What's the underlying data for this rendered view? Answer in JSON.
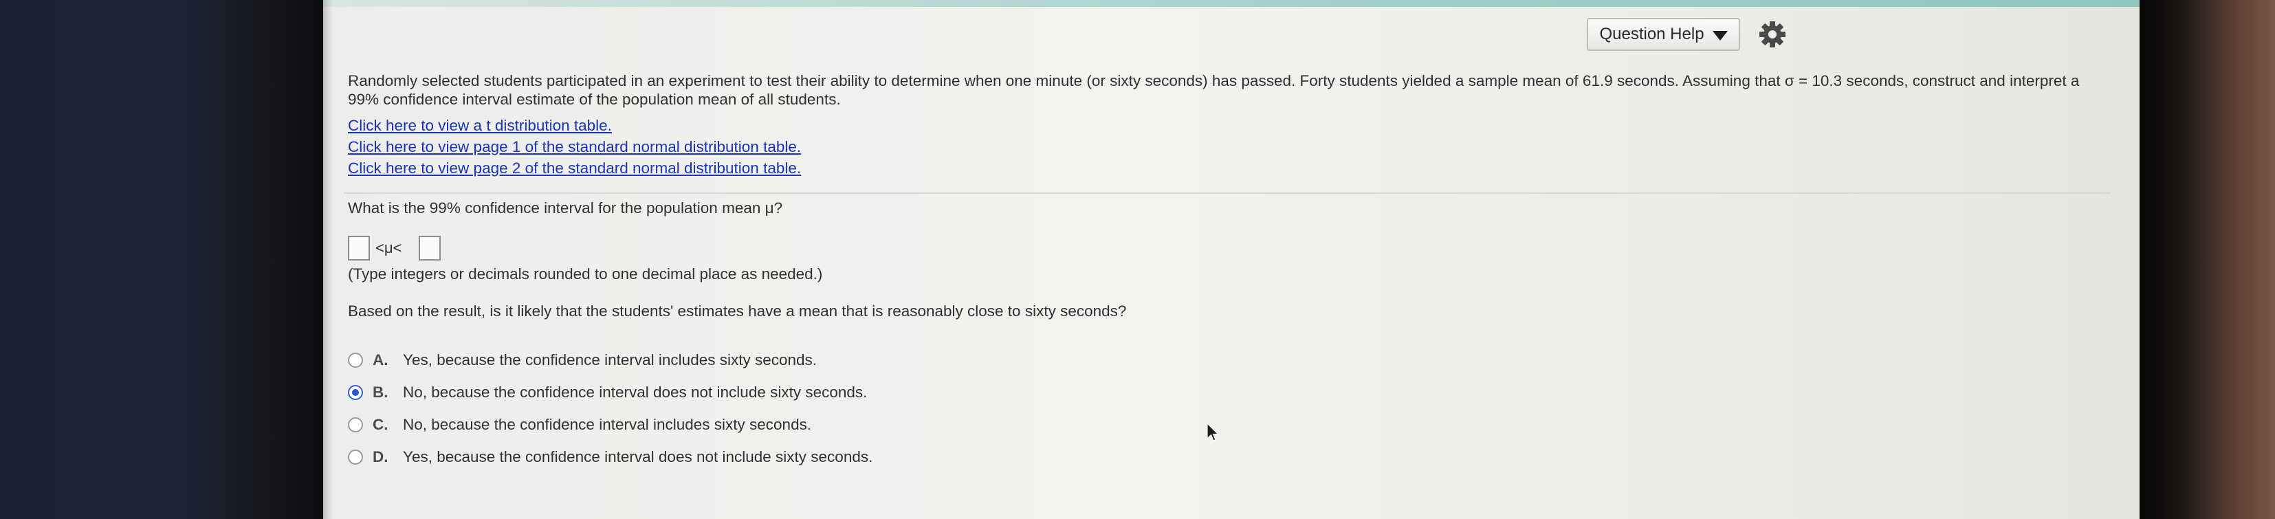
{
  "header": {
    "question_help_label": "Question Help",
    "caret_icon": "caret-down-icon",
    "settings_icon": "gear-icon"
  },
  "problem": {
    "text": "Randomly selected students participated in an experiment to test their ability to determine when one minute (or sixty seconds) has passed. Forty students yielded a sample mean of 61.9 seconds. Assuming that σ = 10.3 seconds, construct and interpret a 99% confidence interval estimate of the population mean of all students."
  },
  "links": [
    "Click here to view a t distribution table.",
    "Click here to view page 1 of the standard normal distribution table.",
    "Click here to view page 2 of the standard normal distribution table."
  ],
  "question1": {
    "prompt": "What is the 99% confidence interval for the population mean μ?",
    "inequality": "<μ<",
    "lower_value": "",
    "upper_value": "",
    "hint": "(Type integers or decimals rounded to one decimal place as needed.)"
  },
  "question2": {
    "prompt": "Based on the result, is it likely that the students' estimates have a mean that is reasonably close to sixty seconds?",
    "selected": "B",
    "options": [
      {
        "letter": "A.",
        "text": "Yes, because the confidence interval includes sixty seconds."
      },
      {
        "letter": "B.",
        "text": "No, because the confidence interval does not include sixty seconds."
      },
      {
        "letter": "C.",
        "text": "No, because the confidence interval includes sixty seconds."
      },
      {
        "letter": "D.",
        "text": "Yes, because the confidence interval does not include sixty seconds."
      }
    ]
  },
  "colors": {
    "link": "#1a34b8",
    "radio_selected": "#2758c9",
    "teal_bar": "#8fc7bd"
  }
}
